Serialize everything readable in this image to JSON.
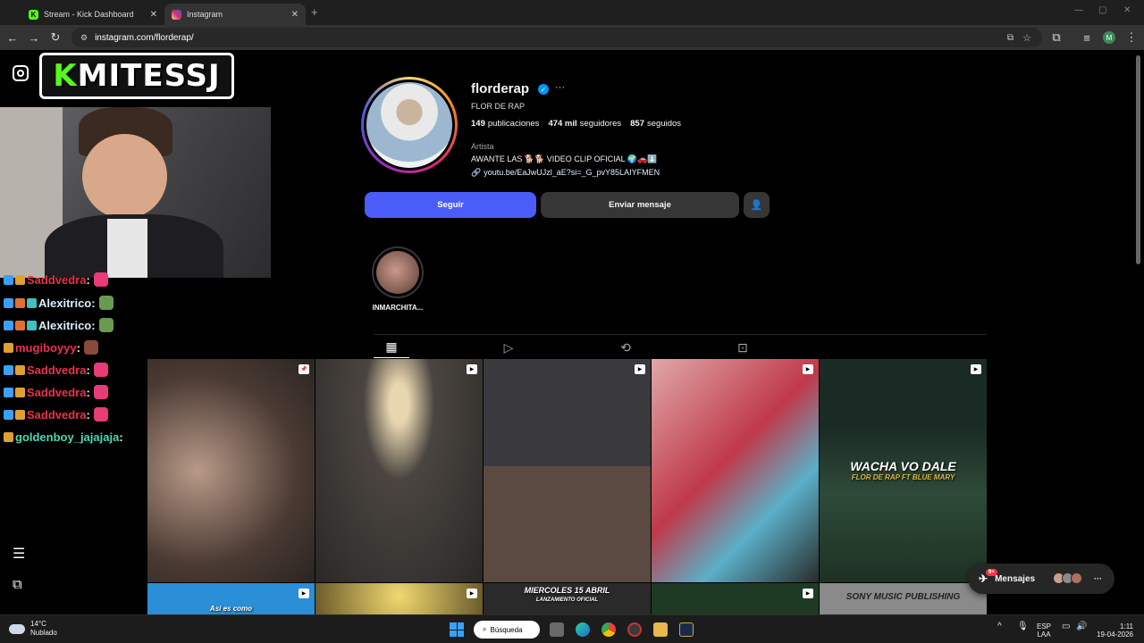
{
  "browser": {
    "tabs": [
      {
        "label": "Stream - Kick Dashboard",
        "favicon": "kick-icon",
        "color": "#53fc18"
      },
      {
        "label": "Instagram",
        "favicon": "instagram-icon",
        "color": "#d62976"
      }
    ],
    "url": "instagram.com/florderap/"
  },
  "overlay": {
    "banner_k": "K",
    "banner_rest": "MITESSJ",
    "chat": [
      {
        "user": "Saddvedra",
        "sep": " :",
        "color": "#e9324b"
      },
      {
        "user": "Alexitrico",
        "sep": " :",
        "color": "#d8f0ff"
      },
      {
        "user": "Alexitrico",
        "sep": " :",
        "color": "#d8f0ff"
      },
      {
        "user": "mugiboyyy",
        "sep": " :",
        "color": "#e9324b"
      },
      {
        "user": "Saddvedra",
        "sep": " :",
        "color": "#e9324b"
      },
      {
        "user": "Saddvedra",
        "sep": " :",
        "color": "#e9324b"
      },
      {
        "user": "Saddvedra",
        "sep": " :",
        "color": "#e9324b"
      },
      {
        "user": "goldenboy_jajajaja",
        "sep": " :",
        "color": "#4fd6b0"
      }
    ]
  },
  "profile": {
    "username": "florderap",
    "full_name": "FLOR DE RAP",
    "stats": {
      "posts_count": "149",
      "posts_label": "publicaciones",
      "followers_count": "474 mil",
      "followers_label": "seguidores",
      "following_count": "857",
      "following_label": "seguidos"
    },
    "category": "Artista",
    "bio": "AWANTE LAS 🐕🐕 VIDEO CLIP OFICIAL 🌍🚗⬇️",
    "link": "youtu.be/EaJwUJzl_aE?si=_G_pvY85LAIYFMEN",
    "follow_label": "Seguir",
    "message_label": "Enviar mensaje",
    "highlight_label": "INMARCHITA..."
  },
  "posts": [
    {
      "caption": ""
    },
    {
      "caption": ""
    },
    {
      "caption": ""
    },
    {
      "caption": ""
    },
    {
      "caption": "WACHA VO DALE",
      "sub": "FLOR DE RAP FT BLUE MARY"
    },
    {
      "caption": "Asi es como"
    },
    {
      "caption": ""
    },
    {
      "caption": "MIERCOLES 15 ABRIL",
      "sub": "LANZAMIENTO OFICIAL"
    },
    {
      "caption": ""
    },
    {
      "caption": "SONY MUSIC PUBLISHING"
    }
  ],
  "messages": {
    "label": "Mensajes",
    "count": "9+"
  },
  "taskbar": {
    "temp": "14°C",
    "weather": "Nublado",
    "search": "Búsqueda",
    "lang_top": "ESP",
    "lang_bottom": "LAA",
    "time": "1:11",
    "date": "19-04-2026"
  }
}
